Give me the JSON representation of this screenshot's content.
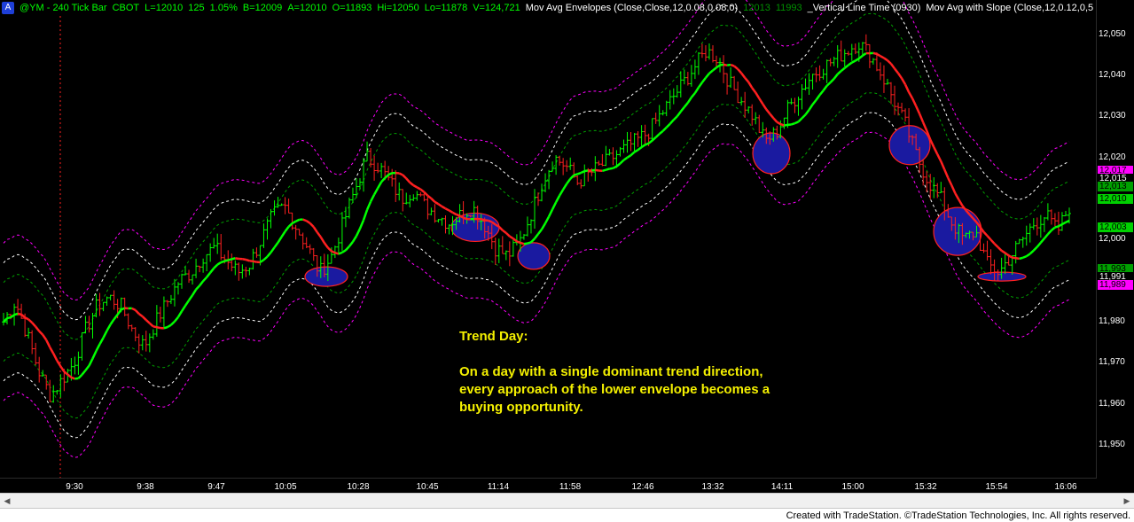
{
  "header": {
    "badge": "A",
    "symbol": "@YM - 240 Tick Bar",
    "exchange": "CBOT",
    "last": "L=12010",
    "change": "125",
    "change_pct": "1.05%",
    "bid": "B=12009",
    "ask": "A=12010",
    "open": "O=11893",
    "high": "Hi=12050",
    "low": "Lo=11878",
    "volume": "V=124,721",
    "study1": "Mov Avg Envelopes (Close,Close,12,0.08,0.08,0)",
    "study1_v1": "12013",
    "study1_v2": "11993",
    "study2": "_Vertical Line Time (0930)",
    "study3": "Mov Avg with Slope (Close,12,0.12,0,5"
  },
  "price_axis": {
    "ticks": [
      "12,050",
      "12,040",
      "12,030",
      "12,020",
      "12,010",
      "12,000",
      "11,990",
      "11,980",
      "11,970",
      "11,960",
      "11,950"
    ],
    "tick_values": [
      12050,
      12040,
      12030,
      12020,
      12010,
      12000,
      11990,
      11980,
      11970,
      11960,
      11950
    ],
    "labels": [
      {
        "text": "12,017",
        "value": 12017,
        "bg": "#ff00ff",
        "fg": "#000000"
      },
      {
        "text": "12,015",
        "value": 12015,
        "bg": "#000000",
        "fg": "#ffffff"
      },
      {
        "text": "12,013",
        "value": 12013,
        "bg": "#00a000",
        "fg": "#000000"
      },
      {
        "text": "12,010",
        "value": 12010,
        "bg": "#00d000",
        "fg": "#000000"
      },
      {
        "text": "12,003",
        "value": 12003,
        "bg": "#00d000",
        "fg": "#000000"
      },
      {
        "text": "11,993",
        "value": 11993,
        "bg": "#00a000",
        "fg": "#000000"
      },
      {
        "text": "11,991",
        "value": 11991,
        "bg": "#000000",
        "fg": "#ffffff"
      },
      {
        "text": "11,989",
        "value": 11989,
        "bg": "#ff00ff",
        "fg": "#000000"
      }
    ]
  },
  "time_axis": {
    "ticks": [
      "9:30",
      "9:38",
      "9:47",
      "10:05",
      "10:28",
      "10:45",
      "11:14",
      "11:58",
      "12:46",
      "13:32",
      "14:11",
      "15:00",
      "15:32",
      "15:54",
      "16:06"
    ]
  },
  "chart_data": {
    "type": "candlestick",
    "ylim": [
      11944,
      12054
    ],
    "grid": false,
    "close_approx": [
      11980,
      11985,
      11977,
      11968,
      11962,
      11966,
      11970,
      11978,
      11984,
      11986,
      11984,
      11978,
      11974,
      11980,
      11985,
      11990,
      11992,
      11996,
      11998,
      11995,
      11992,
      11994,
      12000,
      12006,
      12008,
      12003,
      11998,
      11992,
      11996,
      12004,
      12012,
      12020,
      12018,
      12014,
      12010,
      12012,
      12008,
      12006,
      12004,
      12006,
      12008,
      12004,
      11998,
      11996,
      11999,
      12006,
      12014,
      12020,
      12018,
      12014,
      12016,
      12018,
      12020,
      12022,
      12024,
      12026,
      12030,
      12034,
      12038,
      12042,
      12046,
      12044,
      12038,
      12034,
      12030,
      12024,
      12026,
      12032,
      12036,
      12040,
      12042,
      12044,
      12046,
      12048,
      12045,
      12040,
      12034,
      12028,
      12020,
      12014,
      12010,
      12004,
      12000,
      12002,
      11994,
      11992,
      11996,
      12000,
      12004,
      12006,
      12002,
      12008
    ],
    "highlight_zones": [
      {
        "time": "10:20",
        "price": 11991
      },
      {
        "time": "10:55",
        "price": 12003
      },
      {
        "time": "11:40",
        "price": 11996
      },
      {
        "time": "13:58",
        "price": 12021
      },
      {
        "time": "15:26",
        "price": 12023
      },
      {
        "time": "15:48",
        "price": 12002
      },
      {
        "time": "15:56",
        "price": 11991
      }
    ]
  },
  "colors": {
    "background": "#000000",
    "bull": "#00ff00",
    "bear": "#ff2020",
    "envelope_outer": "#ff00ff",
    "envelope_mid": "#ffffff",
    "envelope_inner": "#00a000",
    "highlight_fill": "#1a1aa0",
    "highlight_border": "#ff2020",
    "annotation": "#f4f000"
  },
  "annotation": {
    "title": "Trend Day:",
    "line1": "On a day with a single dominant trend direction,",
    "line2": "every approach of the lower envelope becomes a",
    "line3": "buying opportunity."
  },
  "footer": {
    "text": "Created with TradeStation. ©TradeStation Technologies, Inc. All rights reserved."
  }
}
